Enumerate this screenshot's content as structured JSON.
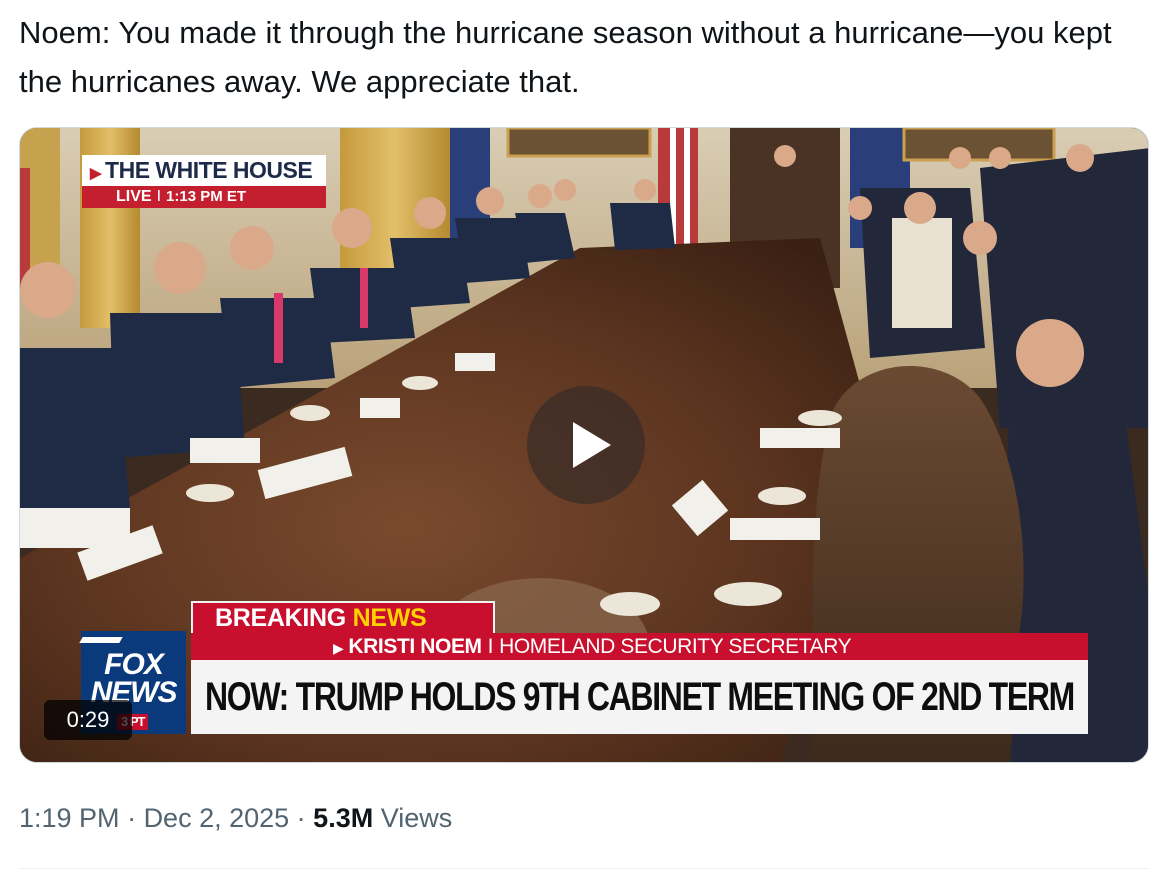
{
  "tweet": {
    "text": "Noem: You made it through the hurricane season without a hurricane—you kept the hurricanes away. We appreciate that."
  },
  "video": {
    "network_banner_top": "THE WHITE HOUSE",
    "network_banner_live": "LIVE",
    "network_banner_sep": "I",
    "network_banner_time": "1:13 PM ET",
    "breaking_label_1": "BREAKING ",
    "breaking_label_2": "NEWS",
    "speaker_name": "KRISTI NOEM",
    "speaker_sep": "I",
    "speaker_title": "HOMELAND SECURITY SECRETARY",
    "headline": "NOW: TRUMP HOLDS 9TH CABINET MEETING OF 2ND TERM",
    "logo_line1": "FOX",
    "logo_line2": "NEWS",
    "logo_bottom": "3 PT",
    "duration": "0:29",
    "play_icon": "play-icon"
  },
  "meta": {
    "time": "1:19 PM",
    "sep1": " · ",
    "date": "Dec 2, 2025",
    "sep2": " · ",
    "views_count": "5.3M",
    "views_label": " Views"
  },
  "colors": {
    "fox_red": "#c8102e",
    "fox_blue": "#0b3a7c",
    "news_yellow": "#ffd200",
    "text_primary": "#0f1419",
    "text_secondary": "#536471"
  }
}
